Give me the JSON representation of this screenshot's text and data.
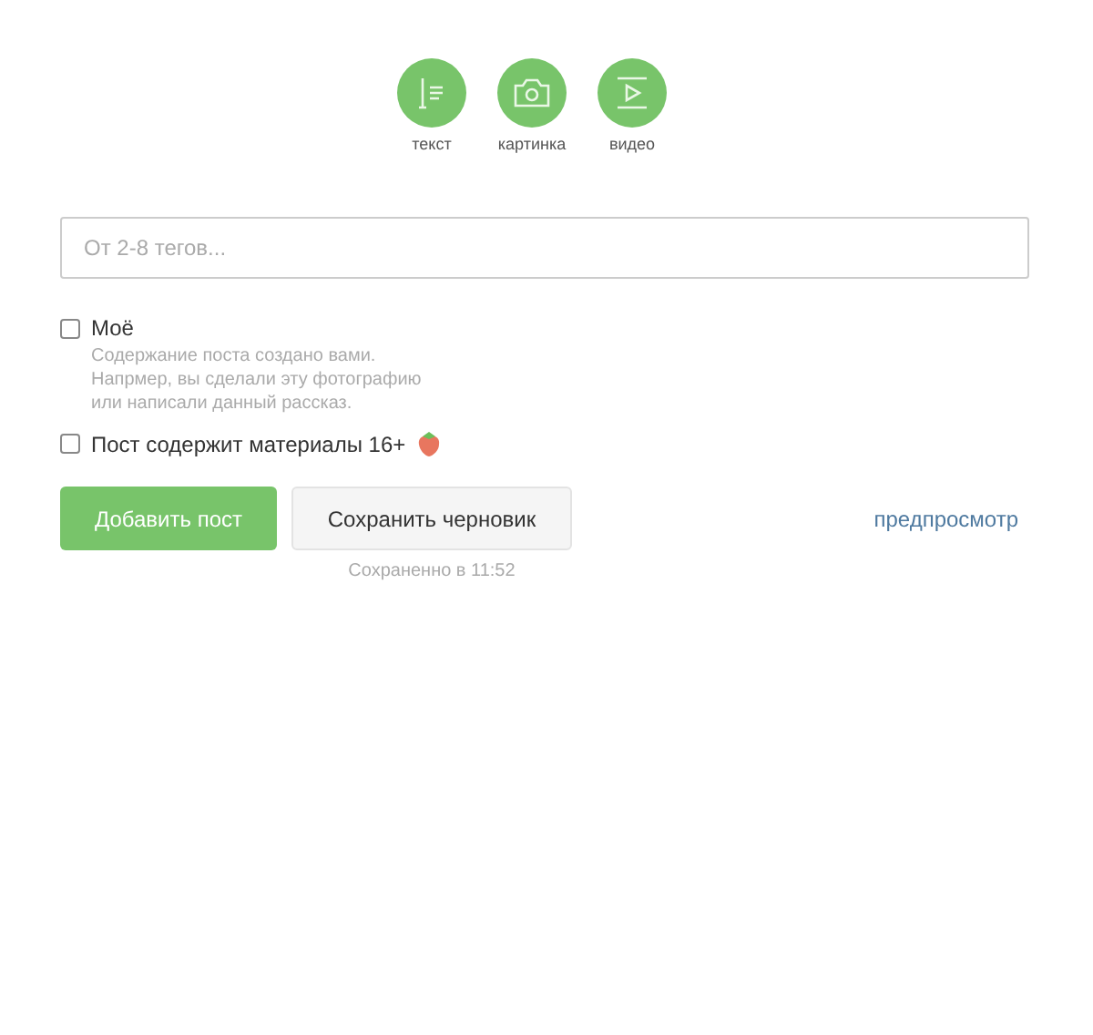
{
  "post_types": [
    {
      "kind": "text",
      "label": "текст"
    },
    {
      "kind": "photo",
      "label": "картинка"
    },
    {
      "kind": "video",
      "label": "видео"
    }
  ],
  "tags_field": {
    "placeholder": "От 2-8 тегов..."
  },
  "options": [
    {
      "kind": "mine",
      "label": "Моё",
      "checked": false,
      "hint": "Содержание поста создано вами. Напрмер, вы сделали эту фотографию или написали данный рассказ."
    },
    {
      "kind": "adult",
      "label": "Пост содержит материалы 16+",
      "checked": false
    }
  ],
  "actions": {
    "publish": "Добавить пост",
    "save_draft": "Сохранить черновик",
    "saved_note": "Сохраненно в 11:52",
    "preview": "предпросмотр"
  }
}
